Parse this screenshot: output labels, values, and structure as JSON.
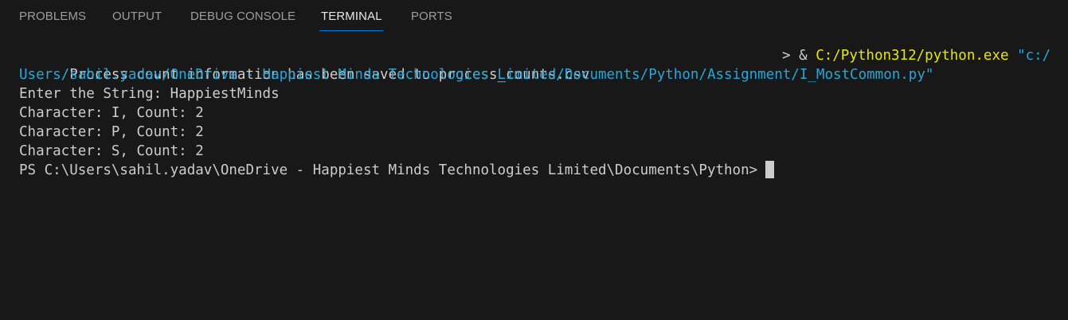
{
  "tabs": [
    {
      "label": "PROBLEMS"
    },
    {
      "label": "OUTPUT"
    },
    {
      "label": "DEBUG CONSOLE"
    },
    {
      "label": "TERMINAL",
      "active": true
    },
    {
      "label": "PORTS"
    }
  ],
  "terminal": {
    "line1_text": "Process count information has been saved to process_counts.csv",
    "command": {
      "prompt_symbol": ">",
      "operator": "&",
      "exe": "C:/Python312/python.exe",
      "arg_part1": "\"c:/",
      "arg_part2": "Users/sahil.yadav/OneDrive - Happiest Minds Technologies Limited/Documents/Python/Assignment/I_MostCommon.py\""
    },
    "output_lines": [
      "Enter the String: HappiestMinds",
      "Character: I, Count: 2",
      "Character: P, Count: 2",
      "Character: S, Count: 2"
    ],
    "prompt": "PS C:\\Users\\sahil.yadav\\OneDrive - Happiest Minds Technologies Limited\\Documents\\Python>"
  },
  "colors": {
    "background": "#181818",
    "tab_active": "#e7e7e7",
    "tab_inactive": "#9d9d9d",
    "tab_underline": "#0078d4",
    "terminal_text": "#cccccc",
    "exe_yellow": "#e5e510",
    "arg_cyan": "#2aa5d8"
  }
}
